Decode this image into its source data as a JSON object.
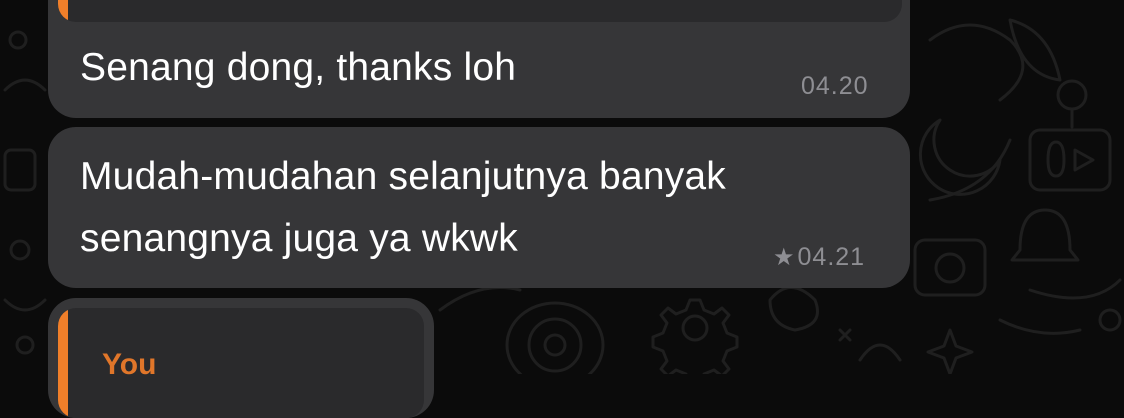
{
  "chat": {
    "messages": [
      {
        "text": "Senang dong, thanks loh",
        "time": "04.20",
        "starred": false
      },
      {
        "line1": "Mudah-mudahan selanjutnya banyak",
        "line2": "senangnya juga ya wkwk",
        "time": "04.21",
        "starred": true,
        "star_glyph": "★"
      }
    ],
    "quoted_reply": {
      "sender": "You"
    }
  },
  "colors": {
    "wallpaper": "#0b0b0b",
    "bubble": "#363638",
    "quote_box": "#2a2a2c",
    "quote_accent": "#f07f2a",
    "timestamp": "#8e8e93"
  },
  "icons": [
    "wallpaper-doodle-pattern",
    "star-icon"
  ]
}
